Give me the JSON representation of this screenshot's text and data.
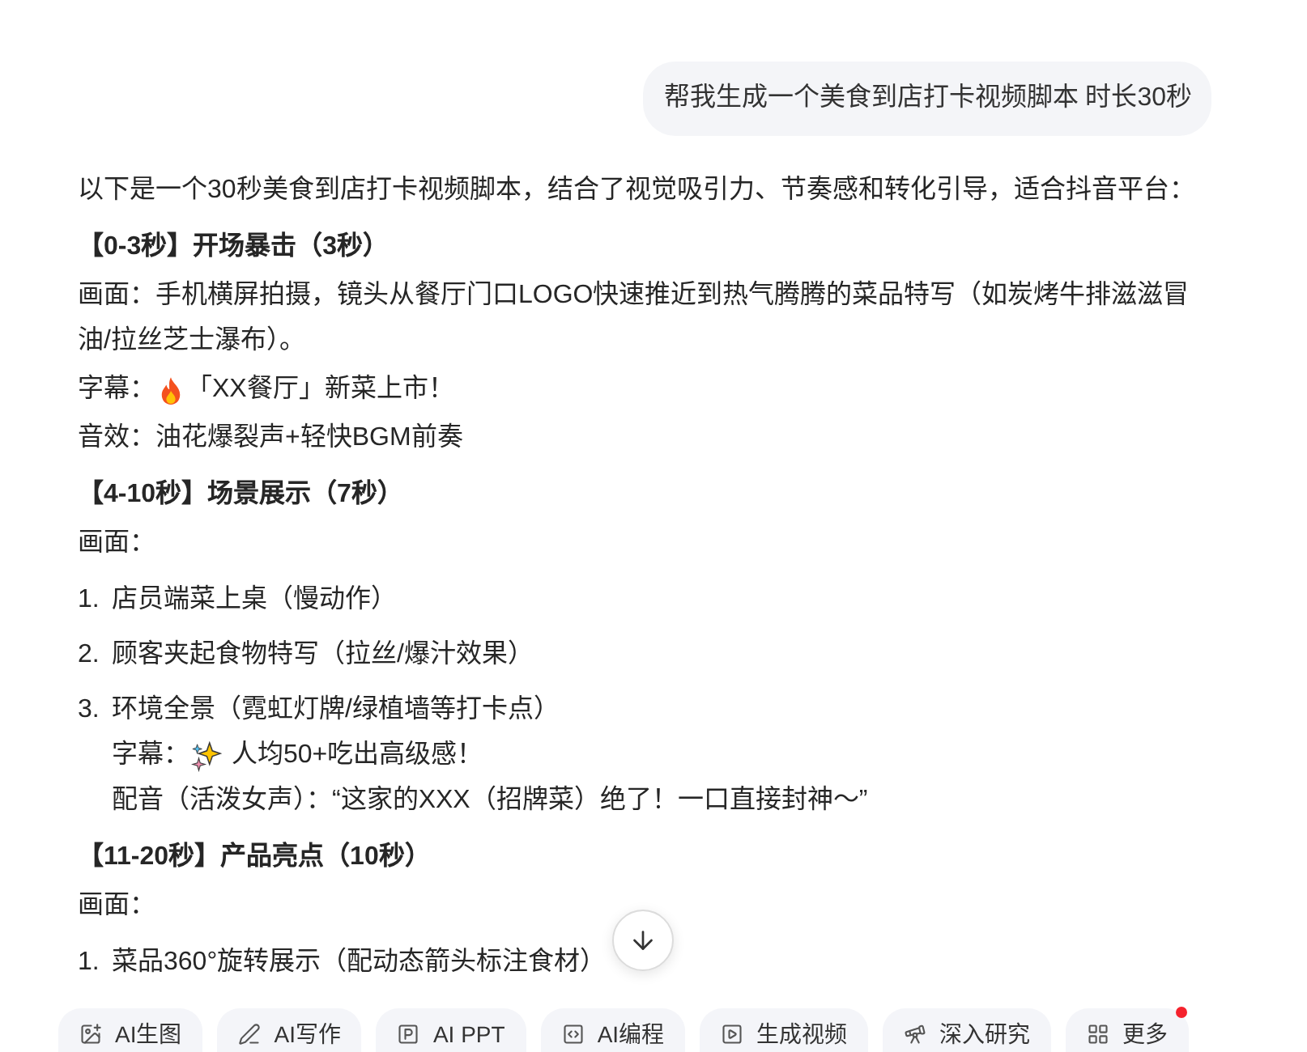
{
  "user_message": {
    "text": "帮我生成一个美食到店打卡视频脚本 时长30秒"
  },
  "answer": {
    "blocks": [
      {
        "kind": "text",
        "text": "以下是一个30秒美食到店打卡视频脚本，结合了视觉吸引力、节奏感和转化引导，适合抖音平台："
      },
      {
        "kind": "heading",
        "text": "【0-3秒】开场暴击（3秒）"
      },
      {
        "kind": "text",
        "text": "画面：手机横屏拍摄，镜头从餐厅门口LOGO快速推近到热气腾腾的菜品特写（如炭烤牛排滋滋冒油/拉丝芝士瀑布）。"
      },
      {
        "kind": "caption",
        "label": "字幕：",
        "text": "「XX餐厅」新菜上市！"
      },
      {
        "kind": "text",
        "text": "音效：油花爆裂声+轻快BGM前奏"
      },
      {
        "kind": "heading",
        "text": "【4-10秒】场景展示（7秒）"
      },
      {
        "kind": "text",
        "text": "画面："
      },
      {
        "kind": "list",
        "items": [
          {
            "number": "1.",
            "text": "店员端菜上桌（慢动作）"
          },
          {
            "number": "2.",
            "text": "顾客夹起食物特写（拉丝/爆汁效果）"
          },
          {
            "number": "3.",
            "text": "环境全景（霓虹灯牌/绿植墙等打卡点）",
            "lines": [
              {
                "kind": "caption",
                "label": "字幕：",
                "text": "人均50+吃出高级感！"
              },
              {
                "kind": "text",
                "text": "配音（活泼女声）：“这家的XXX（招牌菜）绝了！一口直接封神～”"
              }
            ]
          }
        ]
      },
      {
        "kind": "heading",
        "text": "【11-20秒】产品亮点（10秒）"
      },
      {
        "kind": "text",
        "text": "画面："
      },
      {
        "kind": "list",
        "items": [
          {
            "number": "1.",
            "text": "菜品360°旋转展示（配动态箭头标注食材）"
          }
        ]
      }
    ]
  },
  "toolbar": {
    "items": [
      {
        "label": "AI生图",
        "dot": false
      },
      {
        "label": "AI写作",
        "dot": false
      },
      {
        "label": "AI PPT",
        "dot": false
      },
      {
        "label": "AI编程",
        "dot": false
      },
      {
        "label": "生成视频",
        "dot": false
      },
      {
        "label": "深入研究",
        "dot": false
      },
      {
        "label": "更多",
        "dot": true
      }
    ]
  }
}
